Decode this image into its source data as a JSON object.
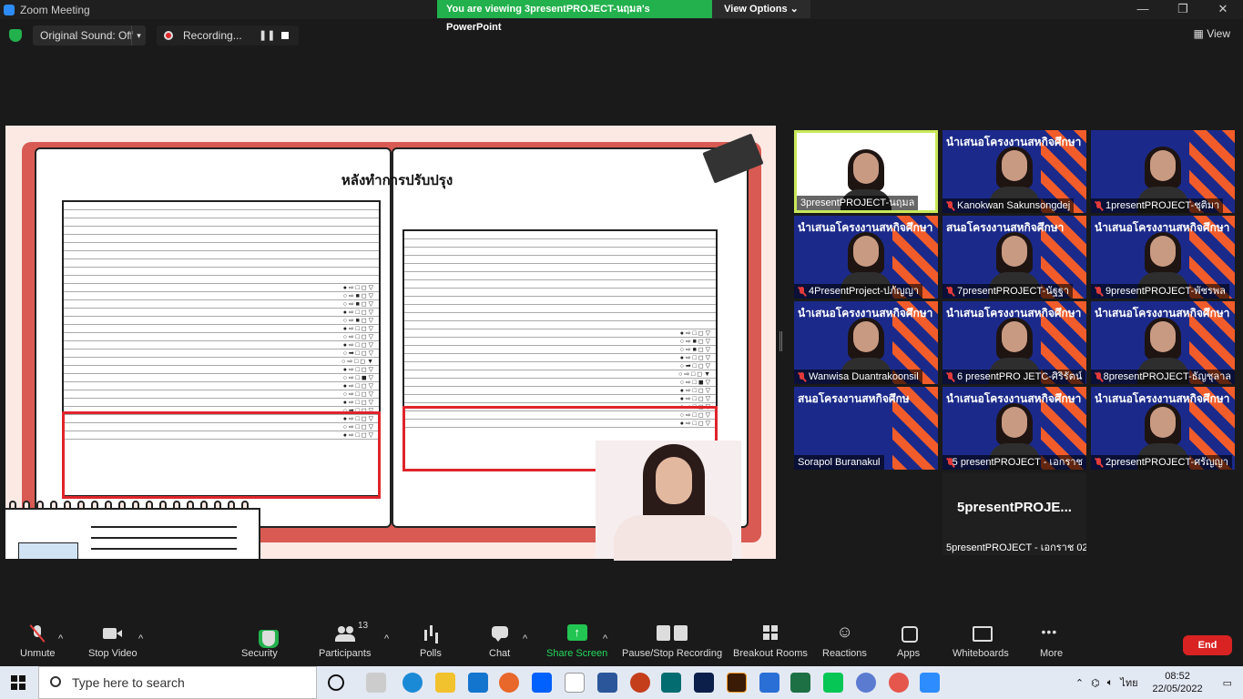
{
  "window": {
    "title": "Zoom Meeting"
  },
  "share_banner": {
    "text": "You are viewing 3presentPROJECT-นฤมล's PowerPoint",
    "view_options": "View Options ⌄"
  },
  "topbar": {
    "original_sound": "Original Sound: Off",
    "recording": "Recording...",
    "view": "View"
  },
  "slide": {
    "title": "หลังทำการปรับปรุง"
  },
  "gallery": [
    {
      "name": "3presentPROJECT-นฤมล",
      "active": true,
      "type": "slide"
    },
    {
      "name": "Kanokwan Sakunsongdej",
      "type": "banner",
      "banner": "นำเสนอโครงงานสหกิจศึกษา"
    },
    {
      "name": "1presentPROJECT-ชุติมา",
      "type": "person"
    },
    {
      "name": "4PresentProject-ปภัญญา",
      "type": "banner",
      "banner": "นำเสนอโครงงานสหกิจศึกษา"
    },
    {
      "name": "7presentPROJECT-นัฐฐา",
      "type": "banner",
      "banner": "สนอโครงงานสหกิจศึกษา"
    },
    {
      "name": "9presentPROJECT-พัชรพล",
      "type": "banner",
      "banner": "นำเสนอโครงงานสหกิจศึกษา"
    },
    {
      "name": "Wanwisa Duantrakoonsil",
      "type": "banner",
      "banner": "นำเสนอโครงงานสหกิจศึกษา"
    },
    {
      "name": "6 presentPRO JETC-ศิริรัตน์",
      "type": "banner",
      "banner": "นำเสนอโครงงานสหกิจศึกษา"
    },
    {
      "name": "8presentPROJECT-ธัญชุลาล",
      "type": "banner",
      "banner": "นำเสนอโครงงานสหกิจศึกษา"
    },
    {
      "name": "Sorapol Buranakul",
      "type": "banner",
      "banner": "สนอโครงงานสหกิจศึกษ"
    },
    {
      "name": "5 presentPROJECT - เอกราช",
      "type": "banner",
      "banner": "นำเสนอโครงงานสหกิจศึกษา"
    },
    {
      "name": "2presentPROJECT-ศรัญญา",
      "type": "banner",
      "banner": "นำเสนอโครงงานสหกิจศึกษา"
    },
    {
      "name": "5presentPROJECT - เอกราช 02",
      "type": "text",
      "big": "5presentPROJE..."
    }
  ],
  "toolbar": {
    "unmute": "Unmute",
    "stop_video": "Stop Video",
    "security": "Security",
    "participants": "Participants",
    "participants_count": "13",
    "polls": "Polls",
    "chat": "Chat",
    "share_screen": "Share Screen",
    "pause_recording": "Pause/Stop Recording",
    "breakout_rooms": "Breakout Rooms",
    "reactions": "Reactions",
    "apps": "Apps",
    "whiteboards": "Whiteboards",
    "more": "More",
    "end": "End"
  },
  "taskbar": {
    "search_placeholder": "Type here to search",
    "time": "08:52",
    "date": "22/05/2022",
    "lang": "ไทย"
  },
  "colors": {
    "share_green": "#22b14c",
    "end_red": "#d92323",
    "active_border": "#c9e85a",
    "highlight_red": "#e0242b"
  }
}
